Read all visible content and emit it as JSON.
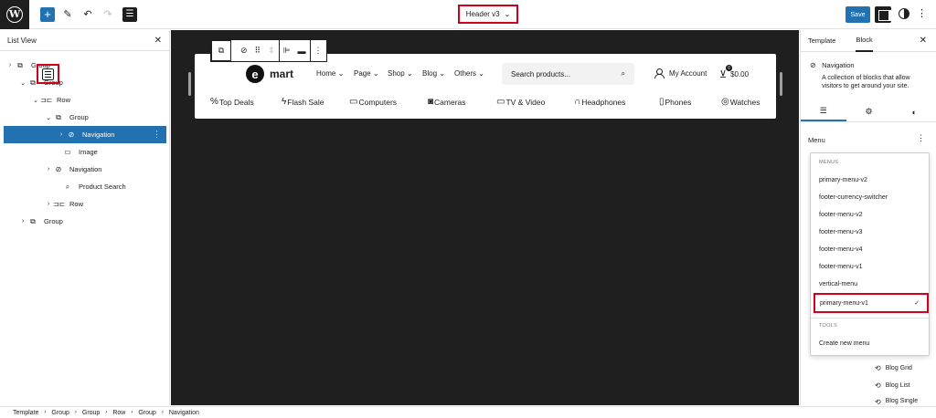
{
  "topbar": {
    "logo_glyph": "W",
    "add_glyph": "+",
    "edit_glyph": "✎",
    "undo_glyph": "↶",
    "redo_glyph": "↷",
    "listview_glyph": "☰",
    "document_title": "Header v3",
    "save_label": "Save"
  },
  "listview": {
    "title": "List View",
    "close_glyph": "✕",
    "rows": [
      {
        "label": "Group",
        "chev": "›",
        "icon": "⧉"
      },
      {
        "label": "Group",
        "chev": "⌄",
        "icon": "⧉"
      },
      {
        "label": "Row",
        "chev": "⌄",
        "icon": "⊐⊏"
      },
      {
        "label": "Group",
        "chev": "⌄",
        "icon": "⧉"
      },
      {
        "label": "Navigation",
        "chev": "›",
        "icon": "⊘"
      },
      {
        "label": "Image",
        "chev": "",
        "icon": "▭"
      },
      {
        "label": "Navigation",
        "chev": "›",
        "icon": "⊘"
      },
      {
        "label": "Product Search",
        "chev": "",
        "icon": "⌕"
      },
      {
        "label": "Row",
        "chev": "›",
        "icon": "⊐⊏"
      },
      {
        "label": "Group",
        "chev": "›",
        "icon": "⧉"
      }
    ]
  },
  "canvas": {
    "logo_letter": "e",
    "logo_text": "mart",
    "menu": [
      "Home",
      "Page",
      "Shop",
      "Blog",
      "Others"
    ],
    "search_placeholder": "Search products...",
    "account_label": "My Account",
    "cart_count": "0",
    "cart_total": "$0.00",
    "categories": [
      {
        "label": "Top Deals",
        "icon": "%"
      },
      {
        "label": "Flash Sale",
        "icon": "ϟ"
      },
      {
        "label": "Computers",
        "icon": "▭"
      },
      {
        "label": "Cameras",
        "icon": "◙"
      },
      {
        "label": "TV & Video",
        "icon": "▭"
      },
      {
        "label": "Headphones",
        "icon": "∩"
      },
      {
        "label": "Phones",
        "icon": "▯"
      },
      {
        "label": "Watches",
        "icon": "◎"
      }
    ]
  },
  "inspector": {
    "tab_template": "Template",
    "tab_block": "Block",
    "close_glyph": "✕",
    "block_title": "Navigation",
    "block_desc": "A collection of blocks that allow visitors to get around your site.",
    "menu_label": "Menu",
    "dropdown": {
      "menus_label": "MENUS",
      "items": [
        "primary-menu-v2",
        "footer-currency-switcher",
        "footer-menu-v2",
        "footer-menu-v3",
        "footer-menu-v4",
        "footer-menu-v1",
        "vertical-menu"
      ],
      "selected": "primary-menu-v1",
      "tools_label": "TOOLS",
      "create_label": "Create new menu"
    },
    "background_blocks": [
      "Blog Grid",
      "Blog List",
      "Blog Single"
    ]
  },
  "breadcrumb": [
    "Template",
    "Group",
    "Group",
    "Row",
    "Group",
    "Navigation"
  ]
}
